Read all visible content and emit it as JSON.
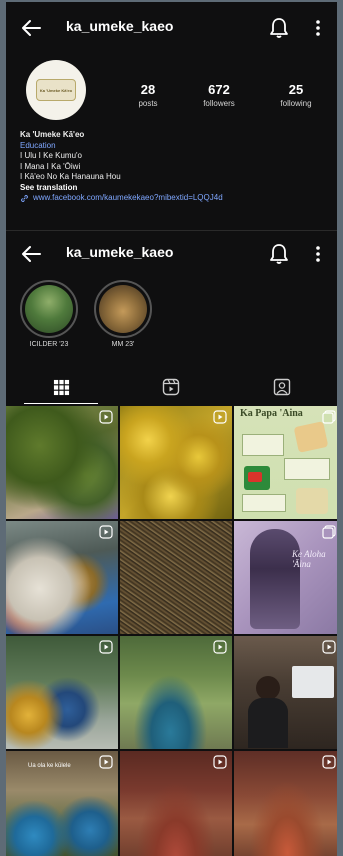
{
  "profile": {
    "username": "ka_umeke_kaeo",
    "avatar_logo_text": "Ka 'Umeke Kā'eo",
    "stats": {
      "posts_count": "28",
      "posts_label": "posts",
      "followers_count": "672",
      "followers_label": "followers",
      "following_count": "25",
      "following_label": "following"
    },
    "bio": {
      "name": "Ka 'Umeke Kā'eo",
      "category": "Education",
      "lines": [
        "I Ulu I Ke Kumu'o",
        "I Mana I Ka 'Ōiwi",
        "I Kā'eo No Ka Hanauna Hou"
      ],
      "see_translation": "See translation",
      "link": "www.facebook.com/kaumekekaeo?mibextid=LQQJ4d"
    }
  },
  "highlights": [
    {
      "label": "ICILDER '23"
    },
    {
      "label": "MM 23'"
    }
  ],
  "tabs": [
    {
      "name": "grid",
      "icon": "grid-icon",
      "active": true
    },
    {
      "name": "reels",
      "icon": "reels-icon",
      "active": false
    },
    {
      "name": "tagged",
      "icon": "tagged-icon",
      "active": false
    }
  ],
  "posts": [
    {
      "type": "reel",
      "desc": "laulau"
    },
    {
      "type": "reel",
      "desc": "starfruit"
    },
    {
      "type": "carousel",
      "title": "Ka Papa 'Aina"
    },
    {
      "type": "reel",
      "desc": "plate"
    },
    {
      "type": "image",
      "desc": "dried leaves"
    },
    {
      "type": "carousel",
      "title": "Ke Aloha 'Āina"
    },
    {
      "type": "reel",
      "desc": "students"
    },
    {
      "type": "reel",
      "desc": "field"
    },
    {
      "type": "reel",
      "desc": "presentation"
    },
    {
      "type": "reel",
      "caption": "Ua ola ke kūlele"
    },
    {
      "type": "reel",
      "desc": "hall"
    },
    {
      "type": "reel",
      "desc": "hall group"
    }
  ],
  "colors": {
    "background": "#0f0f10",
    "link": "#7fa7ff"
  }
}
